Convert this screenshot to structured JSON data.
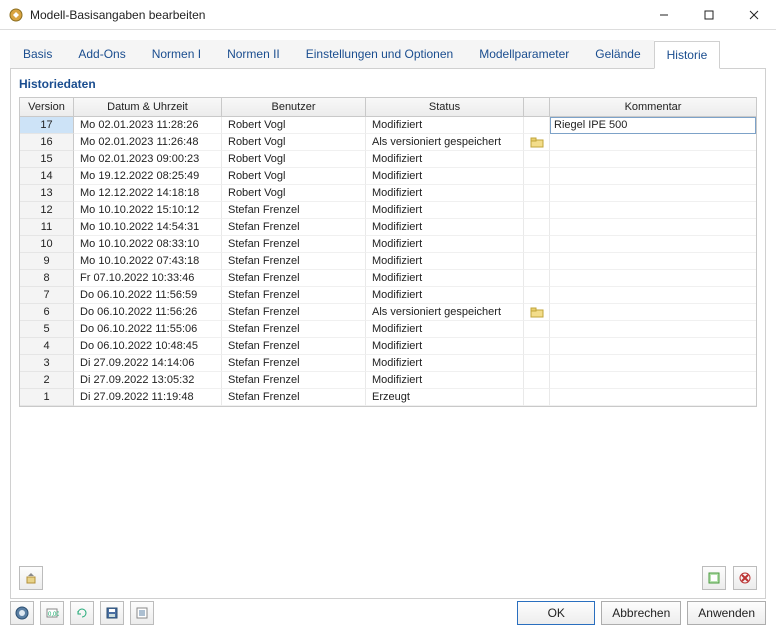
{
  "window": {
    "title": "Modell-Basisangaben bearbeiten",
    "min": "—",
    "max": "☐",
    "close": "✕"
  },
  "tabs": [
    {
      "label": "Basis"
    },
    {
      "label": "Add-Ons"
    },
    {
      "label": "Normen I"
    },
    {
      "label": "Normen II"
    },
    {
      "label": "Einstellungen und Optionen"
    },
    {
      "label": "Modellparameter"
    },
    {
      "label": "Gelände"
    },
    {
      "label": "Historie",
      "active": true
    }
  ],
  "panel": {
    "title": "Historiedaten"
  },
  "grid": {
    "head": {
      "version": "Version",
      "date": "Datum & Uhrzeit",
      "user": "Benutzer",
      "status": "Status",
      "comment": "Kommentar"
    },
    "rows": [
      {
        "v": 17,
        "d": "Mo 02.01.2023 11:28:26",
        "u": "Robert Vogl",
        "s": "Modifiziert",
        "c": "Riegel IPE 500",
        "sel": true,
        "icon": false
      },
      {
        "v": 16,
        "d": "Mo 02.01.2023 11:26:48",
        "u": "Robert Vogl",
        "s": "Als versioniert gespeichert",
        "c": "",
        "sel": false,
        "icon": true
      },
      {
        "v": 15,
        "d": "Mo 02.01.2023 09:00:23",
        "u": "Robert Vogl",
        "s": "Modifiziert",
        "c": "",
        "sel": false,
        "icon": false
      },
      {
        "v": 14,
        "d": "Mo 19.12.2022 08:25:49",
        "u": "Robert Vogl",
        "s": "Modifiziert",
        "c": "",
        "sel": false,
        "icon": false
      },
      {
        "v": 13,
        "d": "Mo 12.12.2022 14:18:18",
        "u": "Robert Vogl",
        "s": "Modifiziert",
        "c": "",
        "sel": false,
        "icon": false
      },
      {
        "v": 12,
        "d": "Mo 10.10.2022 15:10:12",
        "u": "Stefan Frenzel",
        "s": "Modifiziert",
        "c": "",
        "sel": false,
        "icon": false
      },
      {
        "v": 11,
        "d": "Mo 10.10.2022 14:54:31",
        "u": "Stefan Frenzel",
        "s": "Modifiziert",
        "c": "",
        "sel": false,
        "icon": false
      },
      {
        "v": 10,
        "d": "Mo 10.10.2022 08:33:10",
        "u": "Stefan Frenzel",
        "s": "Modifiziert",
        "c": "",
        "sel": false,
        "icon": false
      },
      {
        "v": 9,
        "d": "Mo 10.10.2022 07:43:18",
        "u": "Stefan Frenzel",
        "s": "Modifiziert",
        "c": "",
        "sel": false,
        "icon": false
      },
      {
        "v": 8,
        "d": "Fr 07.10.2022 10:33:46",
        "u": "Stefan Frenzel",
        "s": "Modifiziert",
        "c": "",
        "sel": false,
        "icon": false
      },
      {
        "v": 7,
        "d": "Do 06.10.2022 11:56:59",
        "u": "Stefan Frenzel",
        "s": "Modifiziert",
        "c": "",
        "sel": false,
        "icon": false
      },
      {
        "v": 6,
        "d": "Do 06.10.2022 11:56:26",
        "u": "Stefan Frenzel",
        "s": "Als versioniert gespeichert",
        "c": "",
        "sel": false,
        "icon": true
      },
      {
        "v": 5,
        "d": "Do 06.10.2022 11:55:06",
        "u": "Stefan Frenzel",
        "s": "Modifiziert",
        "c": "",
        "sel": false,
        "icon": false
      },
      {
        "v": 4,
        "d": "Do 06.10.2022 10:48:45",
        "u": "Stefan Frenzel",
        "s": "Modifiziert",
        "c": "",
        "sel": false,
        "icon": false
      },
      {
        "v": 3,
        "d": "Di 27.09.2022 14:14:06",
        "u": "Stefan Frenzel",
        "s": "Modifiziert",
        "c": "",
        "sel": false,
        "icon": false
      },
      {
        "v": 2,
        "d": "Di 27.09.2022 13:05:32",
        "u": "Stefan Frenzel",
        "s": "Modifiziert",
        "c": "",
        "sel": false,
        "icon": false
      },
      {
        "v": 1,
        "d": "Di 27.09.2022 11:19:48",
        "u": "Stefan Frenzel",
        "s": "Erzeugt",
        "c": "",
        "sel": false,
        "icon": false
      }
    ]
  },
  "footer": {
    "ok": "OK",
    "cancel": "Abbrechen",
    "apply": "Anwenden"
  }
}
